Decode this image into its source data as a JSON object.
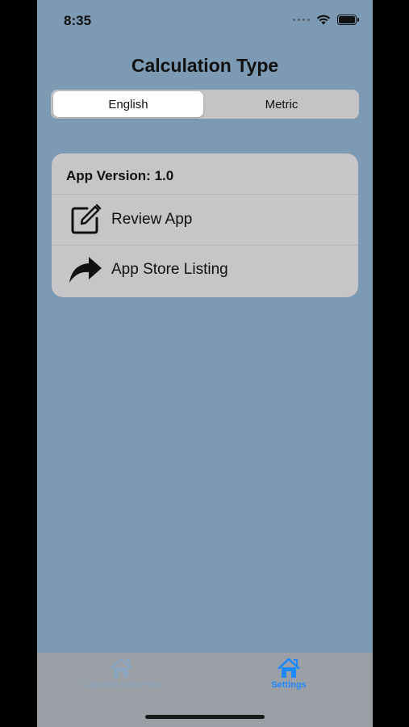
{
  "status_bar": {
    "time": "8:35"
  },
  "header": {
    "title": "Calculation Type"
  },
  "segmented_control": {
    "options": [
      "English",
      "Metric"
    ],
    "selected": "English"
  },
  "card": {
    "app_version": "App Version: 1.0",
    "rows": [
      {
        "label": "Review App",
        "icon": "edit-icon"
      },
      {
        "label": "App Store Listing",
        "icon": "share-arrow-icon"
      }
    ]
  },
  "tab_bar": {
    "tabs": [
      {
        "label": "Calculate Dew Point",
        "icon": "house-icon",
        "active": false
      },
      {
        "label": "Settings",
        "icon": "house-icon",
        "active": true
      }
    ]
  },
  "colors": {
    "background": "#7c9ab3",
    "card": "#c6c6c8",
    "accent": "#1e88ff",
    "inactive_tab": "#8aa6c4"
  }
}
